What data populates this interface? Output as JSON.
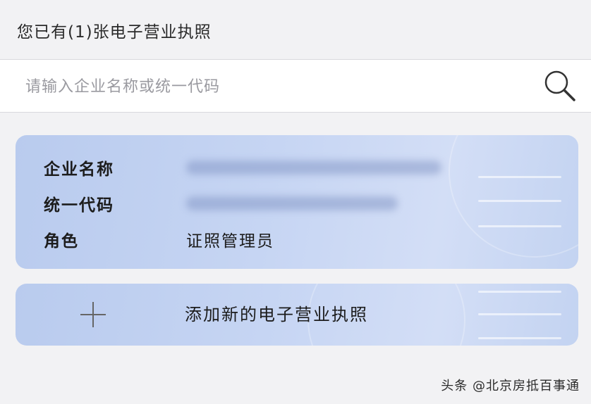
{
  "header": {
    "title": "您已有(1)张电子营业执照"
  },
  "search": {
    "placeholder": "请输入企业名称或统一代码",
    "icon": "search-icon"
  },
  "license_card": {
    "fields": [
      {
        "label": "企业名称",
        "value": "",
        "obscured": true
      },
      {
        "label": "统一代码",
        "value": "",
        "obscured": true
      },
      {
        "label": "角色",
        "value": "证照管理员",
        "obscured": false
      }
    ]
  },
  "add_card": {
    "label": "添加新的电子营业执照",
    "icon": "plus-icon"
  },
  "watermark": {
    "text": "头条 @北京房抵百事通"
  },
  "colors": {
    "background": "#f2f2f4",
    "card_start": "#b9cbee",
    "card_end": "#d3def6",
    "text": "#1c1c1c",
    "placeholder": "#9a9aa0"
  }
}
